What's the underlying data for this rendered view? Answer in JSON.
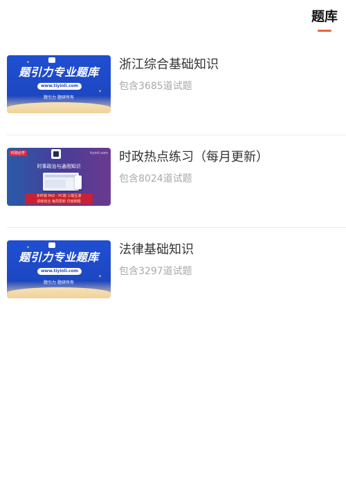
{
  "header": {
    "active_tab": "题库"
  },
  "colors": {
    "accent": "#e8613a",
    "title_text": "#333333",
    "subtitle_text": "#a8a8a8",
    "divider": "#ececec"
  },
  "items": [
    {
      "title": "浙江综合基础知识",
      "subtitle": "包含3685道试题",
      "thumb": {
        "style": "blue",
        "headline": "题引力专业题库",
        "site": "www.tiyinli.com",
        "tagline": "题引力 题研所有"
      }
    },
    {
      "title": "时政热点练习（每月更新）",
      "subtitle": "包含8024道试题",
      "thumb": {
        "style": "purple",
        "tag": "时政必学",
        "site": "tiyinli.com",
        "headline": "时事政治与通用知识",
        "bottom_line1": "多终端  PAD · PC端 三端互通",
        "bottom_line2": "讲练结合 每周更新 月度刷题"
      }
    },
    {
      "title": "法律基础知识",
      "subtitle": "包含3297道试题",
      "thumb": {
        "style": "blue",
        "headline": "题引力专业题库",
        "site": "www.tiyinli.com",
        "tagline": "题引力 题研所有"
      }
    }
  ]
}
